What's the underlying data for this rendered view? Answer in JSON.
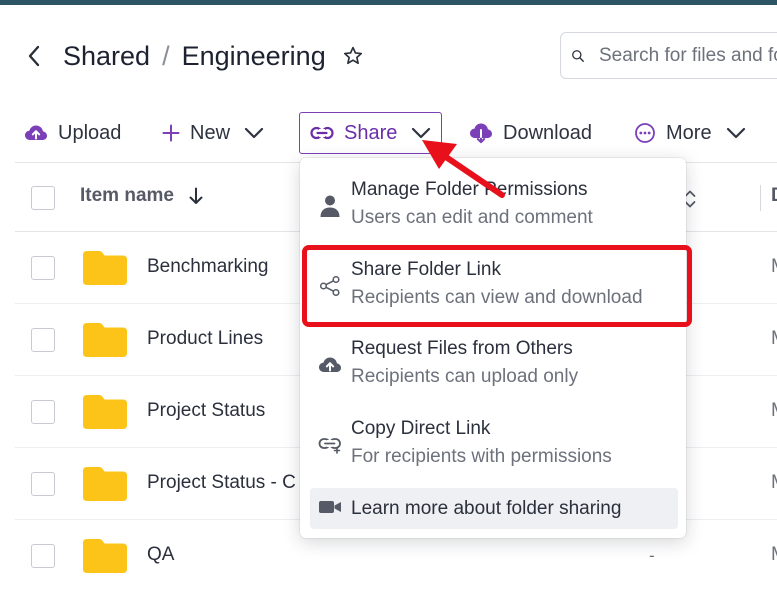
{
  "header": {
    "breadcrumb_root": "Shared",
    "breadcrumb_separator": "/",
    "breadcrumb_current": "Engineering",
    "search_placeholder": "Search for files and folders"
  },
  "toolbar": {
    "upload": "Upload",
    "new": "New",
    "share": "Share",
    "download": "Download",
    "more": "More"
  },
  "table": {
    "col_item_name": "Item name",
    "col_next_partial": "D",
    "rows": [
      {
        "name": "Benchmarking",
        "size": "",
        "modified": "M"
      },
      {
        "name": "Product Lines",
        "size": "",
        "modified": "M"
      },
      {
        "name": "Project Status",
        "size": "",
        "modified": "M"
      },
      {
        "name": "Project Status - C",
        "size": "",
        "modified": "M"
      },
      {
        "name": "QA",
        "size": "-",
        "modified": "M"
      }
    ]
  },
  "share_menu": {
    "items": [
      {
        "title": "Manage Folder Permissions",
        "subtitle": "Users can edit and comment",
        "icon": "person-icon"
      },
      {
        "title": "Share Folder Link",
        "subtitle": "Recipients can view and download",
        "icon": "share-icon"
      },
      {
        "title": "Request Files from Others",
        "subtitle": "Recipients can upload only",
        "icon": "cloud-upload-icon"
      },
      {
        "title": "Copy Direct Link",
        "subtitle": "For recipients with permissions",
        "icon": "link-icon"
      }
    ],
    "learn_more": "Learn more about folder sharing"
  },
  "colors": {
    "accent": "#6a2ea8",
    "folder": "#fcc419",
    "annotation": "#e8101b",
    "topbar": "#2c5663"
  }
}
